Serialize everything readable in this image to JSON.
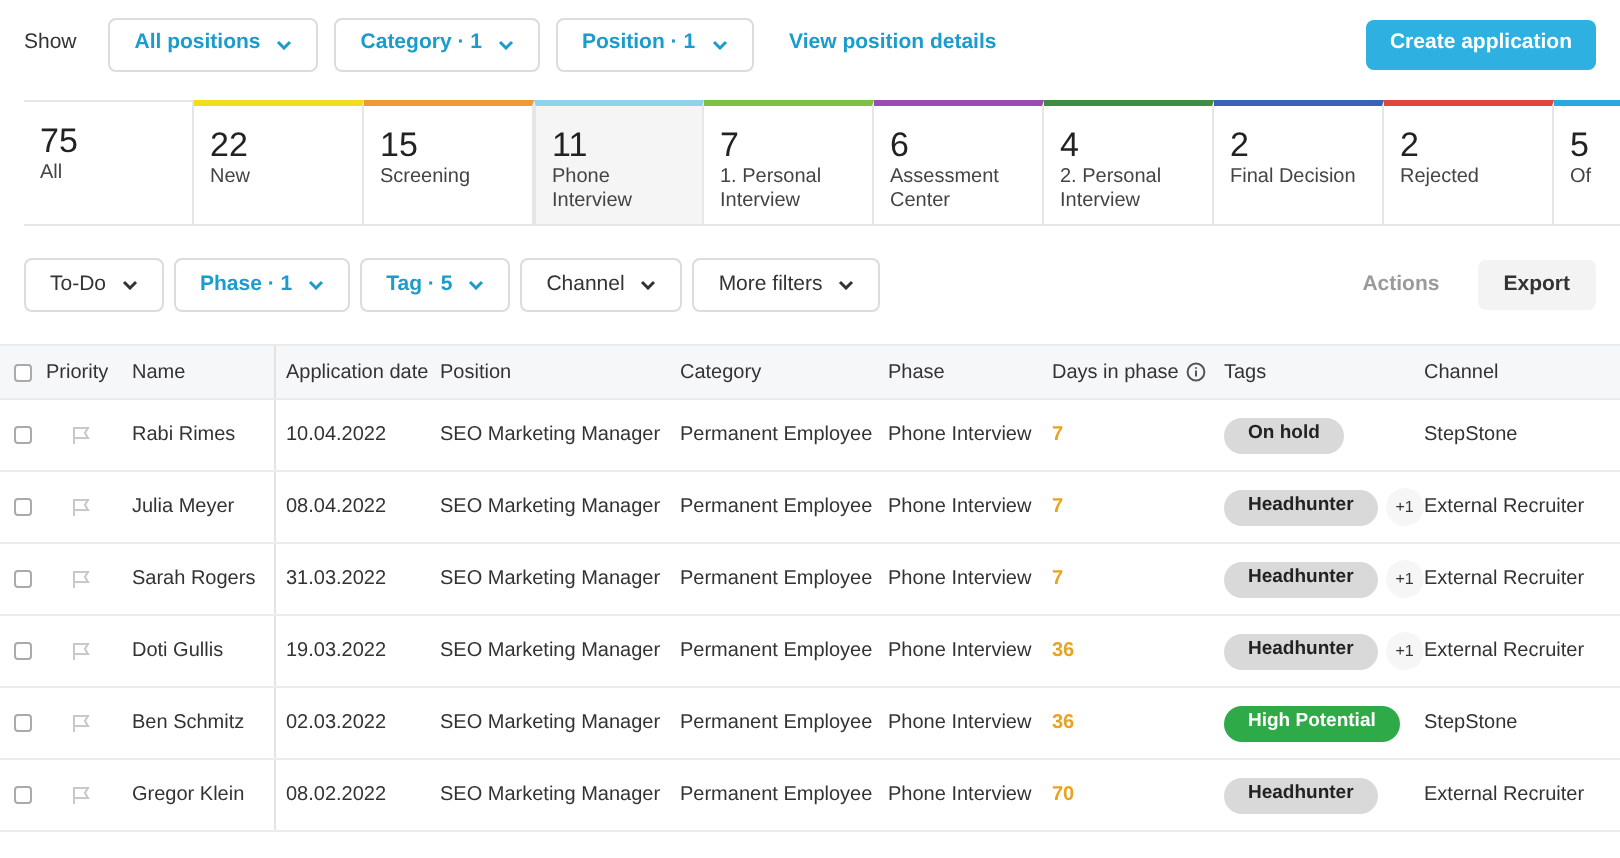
{
  "toolbar": {
    "show_label": "Show",
    "filters": [
      {
        "label": "All positions",
        "active": true
      },
      {
        "label": "Category · 1",
        "active": true
      },
      {
        "label": "Position · 1",
        "active": true
      }
    ],
    "link": "View position details",
    "create_button": "Create application"
  },
  "phases": [
    {
      "count": "75",
      "label": "All",
      "selected": false
    },
    {
      "count": "22",
      "label": "New",
      "selected": false,
      "color": "#f2dc1e"
    },
    {
      "count": "15",
      "label": "Screening",
      "selected": false,
      "color": "#ef9a32"
    },
    {
      "count": "11",
      "label": "Phone Interview",
      "selected": true,
      "color": "#8fd3ea"
    },
    {
      "count": "7",
      "label": "1. Personal Interview",
      "selected": false,
      "color": "#7cc242"
    },
    {
      "count": "6",
      "label": "Assessment Center",
      "selected": false,
      "color": "#9b4cb4"
    },
    {
      "count": "4",
      "label": "2. Personal Interview",
      "selected": false,
      "color": "#3f8c42"
    },
    {
      "count": "2",
      "label": "Final Decision",
      "selected": false,
      "color": "#3a62b8"
    },
    {
      "count": "2",
      "label": "Rejected",
      "selected": false,
      "color": "#e0473c"
    },
    {
      "count": "5",
      "label": "Of",
      "selected": false,
      "color": "#2aa8e0"
    }
  ],
  "filters": [
    {
      "label": "To-Do",
      "active": false
    },
    {
      "label": "Phase · 1",
      "active": true
    },
    {
      "label": "Tag · 5",
      "active": true
    },
    {
      "label": "Channel",
      "active": false
    },
    {
      "label": "More filters",
      "active": false
    }
  ],
  "actions": {
    "label": "Actions",
    "disabled": true
  },
  "export": "Export",
  "table": {
    "select_all_checked": false,
    "columns": [
      "Priority",
      "Name",
      "Application date",
      "Position",
      "Category",
      "Phase",
      "Days in phase",
      "Tags",
      "Channel"
    ],
    "rows": [
      {
        "checked": false,
        "name": "Rabi Rimes",
        "date": "10.04.2022",
        "position": "SEO Marketing Manager",
        "category": "Permanent Employee",
        "phase": "Phone Interview",
        "days": "7",
        "tag": {
          "label": "On hold",
          "color": "#d9d9d9"
        },
        "channel": "StepStone"
      },
      {
        "checked": false,
        "name": "Julia Meyer",
        "date": "08.04.2022",
        "position": "SEO Marketing Manager",
        "category": "Permanent Employee",
        "phase": "Phone Interview",
        "days": "7",
        "tag": {
          "label": "Headhunter",
          "color": "#d9d9d9"
        },
        "more": "+1",
        "channel": "External Recruiter"
      },
      {
        "checked": false,
        "name": "Sarah Rogers",
        "date": "31.03.2022",
        "position": "SEO Marketing Manager",
        "category": "Permanent Employee",
        "phase": "Phone Interview",
        "days": "7",
        "tag": {
          "label": "Headhunter",
          "color": "#d9d9d9"
        },
        "more": "+1",
        "channel": "External Recruiter"
      },
      {
        "checked": false,
        "name": "Doti Gullis",
        "date": "19.03.2022",
        "position": "SEO Marketing Manager",
        "category": "Permanent Employee",
        "phase": "Phone Interview",
        "days": "36",
        "tag": {
          "label": "Headhunter",
          "color": "#d9d9d9"
        },
        "more": "+1",
        "channel": "External Recruiter"
      },
      {
        "checked": false,
        "name": "Ben Schmitz",
        "date": "02.03.2022",
        "position": "SEO Marketing Manager",
        "category": "Permanent Employee",
        "phase": "Phone Interview",
        "days": "36",
        "tag": {
          "label": "High Potential",
          "color": "#2eaa48"
        },
        "channel": "StepStone"
      },
      {
        "checked": false,
        "name": "Gregor Klein",
        "date": "08.02.2022",
        "position": "SEO Marketing Manager",
        "category": "Permanent Employee",
        "phase": "Phone Interview",
        "days": "70",
        "tag": {
          "label": "Headhunter",
          "color": "#d9d9d9"
        },
        "channel": "External Recruiter"
      }
    ]
  }
}
